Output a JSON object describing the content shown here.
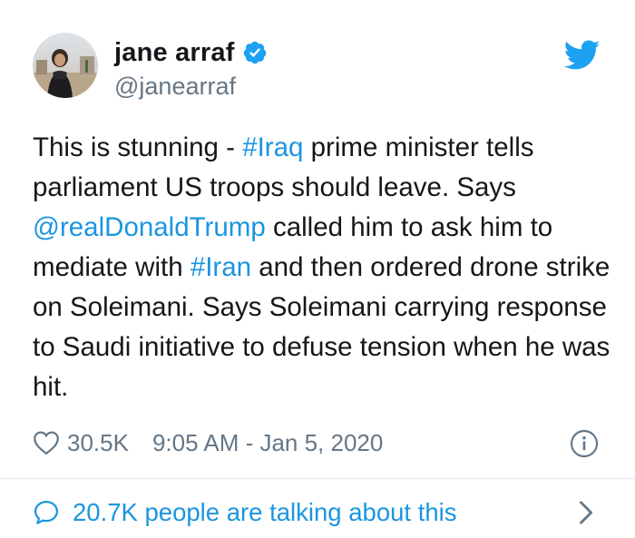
{
  "user": {
    "display_name": "jane arraf",
    "handle": "@janearraf",
    "verified": true
  },
  "tweet": {
    "segments": [
      {
        "type": "text",
        "text": "This is stunning - "
      },
      {
        "type": "hashtag",
        "text": "#Iraq"
      },
      {
        "type": "text",
        "text": " prime minister tells parliament US troops should leave. Says "
      },
      {
        "type": "mention",
        "text": "@realDonaldTrump"
      },
      {
        "type": "text",
        "text": " called him to ask him to mediate with "
      },
      {
        "type": "hashtag",
        "text": "#Iran"
      },
      {
        "type": "text",
        "text": " and then ordered drone strike on Soleimani. Says Soleimani carrying response to Saudi initiative to defuse tension when he was hit."
      }
    ]
  },
  "meta": {
    "likes": "30.5K",
    "timestamp": "9:05 AM - Jan 5, 2020"
  },
  "footer": {
    "talking_text": "20.7K people are talking about this"
  },
  "icons": {
    "verified": "verified-badge-icon",
    "twitter": "twitter-bird-icon",
    "like": "heart-icon",
    "info": "info-icon",
    "reply_bubble": "speech-bubble-icon",
    "chevron": "chevron-right-icon"
  },
  "colors": {
    "link": "#1b95e0",
    "text": "#14171a",
    "muted": "#657786",
    "brand": "#1da1f2",
    "divider": "#e1e8ed"
  }
}
